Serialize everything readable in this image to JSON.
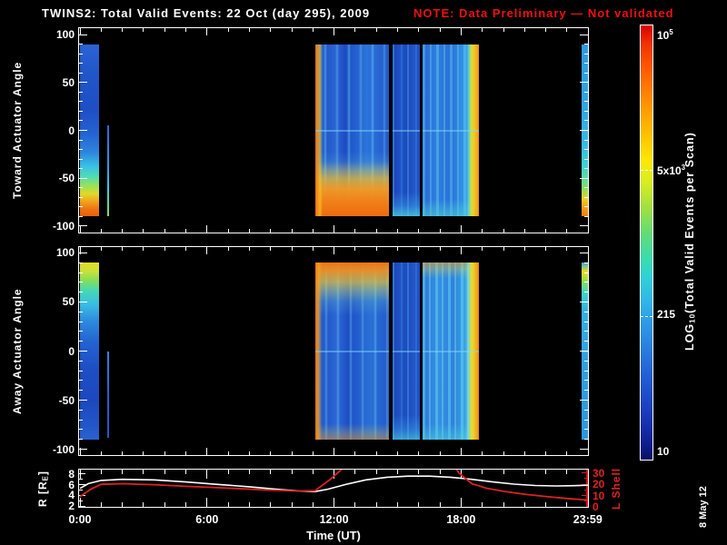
{
  "title": {
    "main": "TWINS2: Total Valid Events: 22 Oct (day 295), 2009",
    "note": "NOTE: Data Preliminary — Not validated"
  },
  "date_stamp": "8 May 12",
  "colors": {
    "background": "#000000",
    "axis": "#ffffff",
    "note_red": "#ee1111",
    "l_shell_red": "#dd2222",
    "r_curve": "#ffffff"
  },
  "chart_data": {
    "type": [
      "heatmap",
      "heatmap",
      "line"
    ],
    "time_axis": {
      "label": "Time (UT)",
      "range_h": [
        0,
        24
      ],
      "minor_step_h": 1,
      "major_step_h": 6,
      "ticks": [
        {
          "h": 0,
          "label": "0:00"
        },
        {
          "h": 6,
          "label": "6:00"
        },
        {
          "h": 12,
          "label": "12:00"
        },
        {
          "h": 18,
          "label": "18:00"
        },
        {
          "h": 23.983,
          "label": "23:59"
        }
      ]
    },
    "angle_axis": {
      "range": [
        -100,
        100
      ],
      "major_ticks": [
        100,
        50,
        0,
        -50,
        -100
      ],
      "minor_step": 10
    },
    "panels": [
      {
        "type": "heatmap",
        "ylabel": "Toward Actuator Angle",
        "blocks": [
          {
            "t0": 0.0,
            "t1": 0.9,
            "a0": 90,
            "a1": -90,
            "style": "b-tw-left",
            "zero_line": false
          },
          {
            "t0": 1.28,
            "t1": 1.37,
            "a0": 5,
            "a1": -90,
            "style": "b-tw-thin",
            "zero_line": false
          },
          {
            "t0": 11.1,
            "t1": 14.6,
            "a0": 90,
            "a1": -90,
            "style": "b-tw-m1",
            "zero_line": true
          },
          {
            "t0": 14.75,
            "t1": 16.04,
            "a0": 90,
            "a1": -90,
            "style": "b-tw-m2",
            "zero_line": true
          },
          {
            "t0": 16.17,
            "t1": 18.85,
            "a0": 90,
            "a1": -90,
            "style": "b-tw-m3",
            "zero_line": true
          },
          {
            "t0": 23.67,
            "t1": 24.0,
            "a0": 90,
            "a1": -90,
            "style": "b-tw-right",
            "zero_line": true
          }
        ]
      },
      {
        "type": "heatmap",
        "ylabel": "Away Actuator Angle",
        "blocks": [
          {
            "t0": 0.0,
            "t1": 0.9,
            "a0": 90,
            "a1": -90,
            "style": "b-aw-left",
            "zero_line": false
          },
          {
            "t0": 1.28,
            "t1": 1.37,
            "a0": 0,
            "a1": -88,
            "style": "b-aw-thin",
            "zero_line": false
          },
          {
            "t0": 11.1,
            "t1": 14.6,
            "a0": 90,
            "a1": -90,
            "style": "b-aw-m1",
            "zero_line": true
          },
          {
            "t0": 14.75,
            "t1": 16.04,
            "a0": 90,
            "a1": -90,
            "style": "b-aw-m2",
            "zero_line": true
          },
          {
            "t0": 16.17,
            "t1": 18.85,
            "a0": 90,
            "a1": -90,
            "style": "b-aw-m3",
            "zero_line": true
          },
          {
            "t0": 23.67,
            "t1": 24.0,
            "a0": 90,
            "a1": -90,
            "style": "b-aw-right",
            "zero_line": true
          }
        ]
      },
      {
        "type": "line",
        "left_axis": {
          "label_parts": [
            [
              "t",
              "R [R"
            ],
            [
              "sub",
              "E"
            ],
            [
              "t",
              "]"
            ]
          ],
          "ticks": [
            8,
            6,
            4,
            2
          ],
          "minor_step": 1,
          "range": [
            1.83,
            8.83
          ]
        },
        "right_axis": {
          "label": "L Shell",
          "ticks": [
            30,
            20,
            10,
            0
          ],
          "minor_step": 5,
          "range": [
            0,
            33
          ],
          "color": "#dd2222"
        },
        "series": [
          {
            "name": "R",
            "color": "#ffffff",
            "points": [
              [
                0,
                5.3
              ],
              [
                0.4,
                6.2
              ],
              [
                1,
                6.8
              ],
              [
                2,
                7.0
              ],
              [
                3.5,
                6.9
              ],
              [
                5,
                6.5
              ],
              [
                6.5,
                6.05
              ],
              [
                8,
                5.6
              ],
              [
                9.5,
                5.05
              ],
              [
                10.4,
                4.8
              ],
              [
                11.1,
                4.7
              ],
              [
                11.7,
                5.15
              ],
              [
                12.5,
                6.0
              ],
              [
                13.5,
                6.9
              ],
              [
                14.5,
                7.4
              ],
              [
                15.5,
                7.6
              ],
              [
                16.5,
                7.6
              ],
              [
                17.5,
                7.4
              ],
              [
                18.5,
                7.0
              ],
              [
                19.5,
                6.5
              ],
              [
                20.5,
                6.1
              ],
              [
                21.5,
                5.85
              ],
              [
                22.5,
                5.75
              ],
              [
                23.3,
                5.8
              ],
              [
                24,
                5.9
              ]
            ]
          },
          {
            "name": "L Shell",
            "color": "#dd2222",
            "points": [
              [
                0,
                9
              ],
              [
                0.5,
                15.5
              ],
              [
                1,
                20
              ],
              [
                2,
                20.5
              ],
              [
                3.5,
                19.6
              ],
              [
                5,
                18.2
              ],
              [
                6.5,
                17
              ],
              [
                8,
                15.7
              ],
              [
                9,
                14.8
              ],
              [
                10.2,
                14.1
              ],
              [
                11.1,
                14.3
              ],
              [
                11.8,
                24
              ],
              [
                12.4,
                34
              ],
              [
                12.8,
                46
              ],
              [
                17.3,
                46
              ],
              [
                17.9,
                30
              ],
              [
                18.5,
                20.5
              ],
              [
                19.2,
                16.5
              ],
              [
                20,
                13.8
              ],
              [
                21,
                11.2
              ],
              [
                22,
                9.2
              ],
              [
                23,
                7.4
              ],
              [
                24,
                6
              ]
            ]
          }
        ]
      }
    ],
    "colorbar": {
      "label_parts": [
        [
          "t",
          "LOG"
        ],
        [
          "sub",
          "10"
        ],
        [
          "t",
          "(Total Valid Events per Scan)"
        ]
      ],
      "ticks": [
        {
          "frac": 0.02,
          "parts": [
            [
              "t",
              "10"
            ],
            [
              "sup",
              "5"
            ]
          ],
          "dash": false
        },
        {
          "frac": 0.333,
          "parts": [
            [
              "t",
              "5x10"
            ],
            [
              "sup",
              "3"
            ]
          ],
          "dash": true
        },
        {
          "frac": 0.669,
          "parts": [
            [
              "t",
              "215"
            ]
          ],
          "dash": true
        },
        {
          "frac": 0.985,
          "parts": [
            [
              "t",
              "10"
            ]
          ],
          "dash": false
        }
      ]
    }
  }
}
